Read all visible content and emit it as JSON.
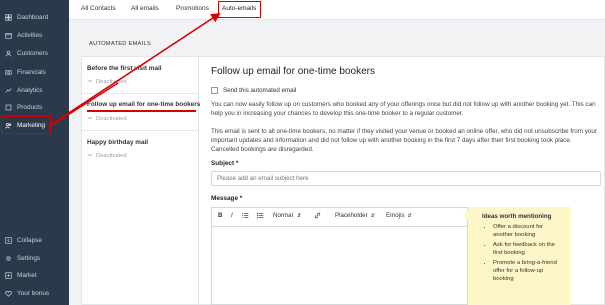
{
  "sidebar": {
    "items": [
      {
        "label": "Dashboard",
        "icon": "dashboard-icon"
      },
      {
        "label": "Activities",
        "icon": "activities-icon"
      },
      {
        "label": "Customers",
        "icon": "customers-icon"
      },
      {
        "label": "Financials",
        "icon": "financials-icon"
      },
      {
        "label": "Analytics",
        "icon": "analytics-icon"
      },
      {
        "label": "Products",
        "icon": "products-icon"
      },
      {
        "label": "Marketing",
        "icon": "marketing-icon"
      }
    ],
    "bottom_items": [
      {
        "label": "Collapse",
        "icon": "collapse-icon"
      },
      {
        "label": "Settings",
        "icon": "gear-icon"
      },
      {
        "label": "Market",
        "icon": "market-icon"
      },
      {
        "label": "Your bonus",
        "icon": "bonus-icon"
      }
    ]
  },
  "tabs": [
    "All Contacts",
    "All emails",
    "Promotions",
    "Auto-emails"
  ],
  "panel": {
    "header": "AUTOMATED EMAILS",
    "list": [
      {
        "title": "Before the first visit mail",
        "status": "Deactivated"
      },
      {
        "title": "Follow up email for one-time bookers",
        "status": "Deactivated"
      },
      {
        "title": "Happy birthday mail",
        "status": "Deactivated"
      }
    ]
  },
  "main": {
    "title": "Follow up email for one-time bookers",
    "send_label": "Send this automated email",
    "para1": "You can now easily follow up on customers who booked any of your offerings once but did not follow up with another booking yet. This can help you in increasing your chances to develop this one-time booker to a regular customer.",
    "para2": "This email is sent to all one-time bookers, no matter if they visited your venue or booked an online offer, who did not unsubscribe from your important updates and information and did not follow up with another booking in the first 7 days after their first booking took place. Cancelled bookings are disregarded.",
    "subject_label": "Subject *",
    "subject_placeholder": "Please add an email subject here",
    "message_label": "Message *",
    "toolbar": {
      "bold": "B",
      "italic": "I",
      "normal": "Normal",
      "placeholder": "Placeholder",
      "emojis": "Emojis"
    }
  },
  "ideas": {
    "title": "Ideas worth mentioning",
    "items": [
      "Offer a discount for another booking",
      "Ask for feedback on the first booking",
      "Promote a bring-a-friend offer for a follow-up booking"
    ]
  },
  "colors": {
    "sidebar_bg": "#2b3a4a",
    "annotation_red": "#d90000",
    "ideas_bg": "#fdf6c9"
  }
}
